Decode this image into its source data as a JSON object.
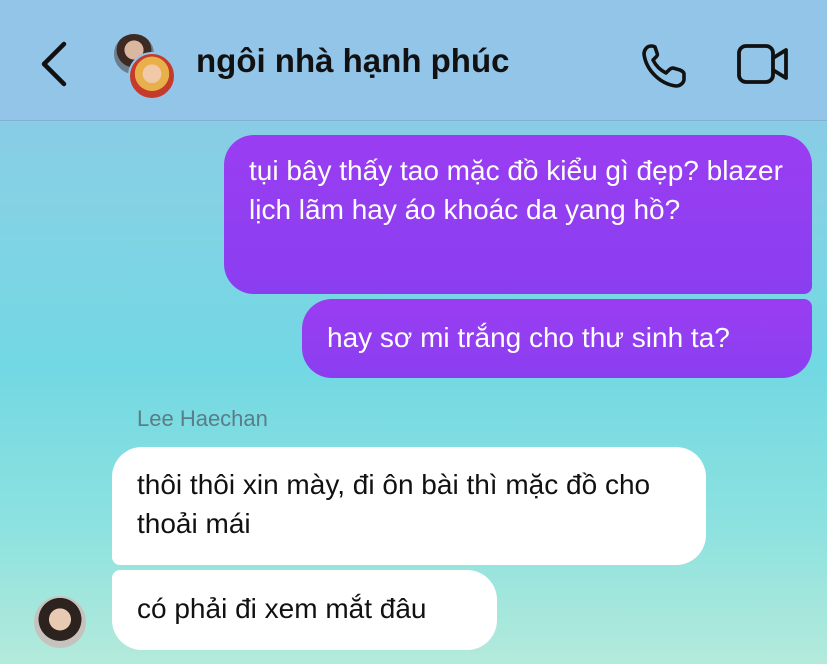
{
  "header": {
    "title": "ngôi nhà hạnh phúc",
    "back_icon": "chevron-left-icon",
    "call_icon": "phone-icon",
    "video_icon": "video-camera-icon"
  },
  "messages": [
    {
      "direction": "outgoing",
      "text": "tụi bây thấy tao mặc đồ kiểu gì đẹp? blazer lịch lãm hay áo khoác da yang hồ?"
    },
    {
      "direction": "outgoing",
      "text": "hay sơ mi trắng cho thư sinh ta?"
    },
    {
      "direction": "incoming",
      "sender": "Lee Haechan",
      "text": "thôi thôi xin mày, đi ôn bài thì mặc đồ cho thoải mái"
    },
    {
      "direction": "incoming",
      "text": "có phải đi xem mắt đâu"
    }
  ],
  "colors": {
    "outgoing_bubble": "#8f3ef1",
    "incoming_bubble": "#ffffff",
    "header_bg": "#93c5e9"
  }
}
